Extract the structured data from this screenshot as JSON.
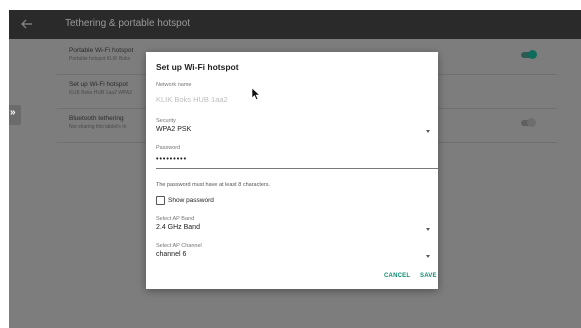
{
  "header": {
    "title": "Tethering & portable hotspot"
  },
  "settings": [
    {
      "title": "Portable Wi-Fi hotspot",
      "summary": "Portable hotspot KLIK Boks",
      "toggle": "on"
    },
    {
      "title": "Set up Wi-Fi hotspot",
      "summary": "KLIK Boks HUB 1aa2 WPA2",
      "toggle": null
    },
    {
      "title": "Bluetooth tethering",
      "summary": "Not sharing this tablet's In",
      "toggle": "off"
    }
  ],
  "side_handle": {
    "glyph": "»"
  },
  "dialog": {
    "title": "Set up Wi-Fi hotspot",
    "network_name": {
      "label": "Network name",
      "placeholder": "KLIK Boks HUB 1aa2"
    },
    "security": {
      "label": "Security",
      "value": "WPA2 PSK"
    },
    "password": {
      "label": "Password",
      "value": "•••••••••"
    },
    "helper_text": "The password must have at least 8 characters.",
    "show_password": {
      "label": "Show password",
      "checked": false
    },
    "ap_band": {
      "label": "Select AP Band",
      "value": "2.4 GHz Band"
    },
    "ap_channel": {
      "label": "Select AP Channel",
      "value": "channel 6"
    },
    "buttons": {
      "cancel": "CANCEL",
      "save": "SAVE"
    }
  },
  "colors": {
    "accent": "#0f8b72",
    "scrim": "#7d7d7d",
    "topbar": "#2a2a2a"
  }
}
